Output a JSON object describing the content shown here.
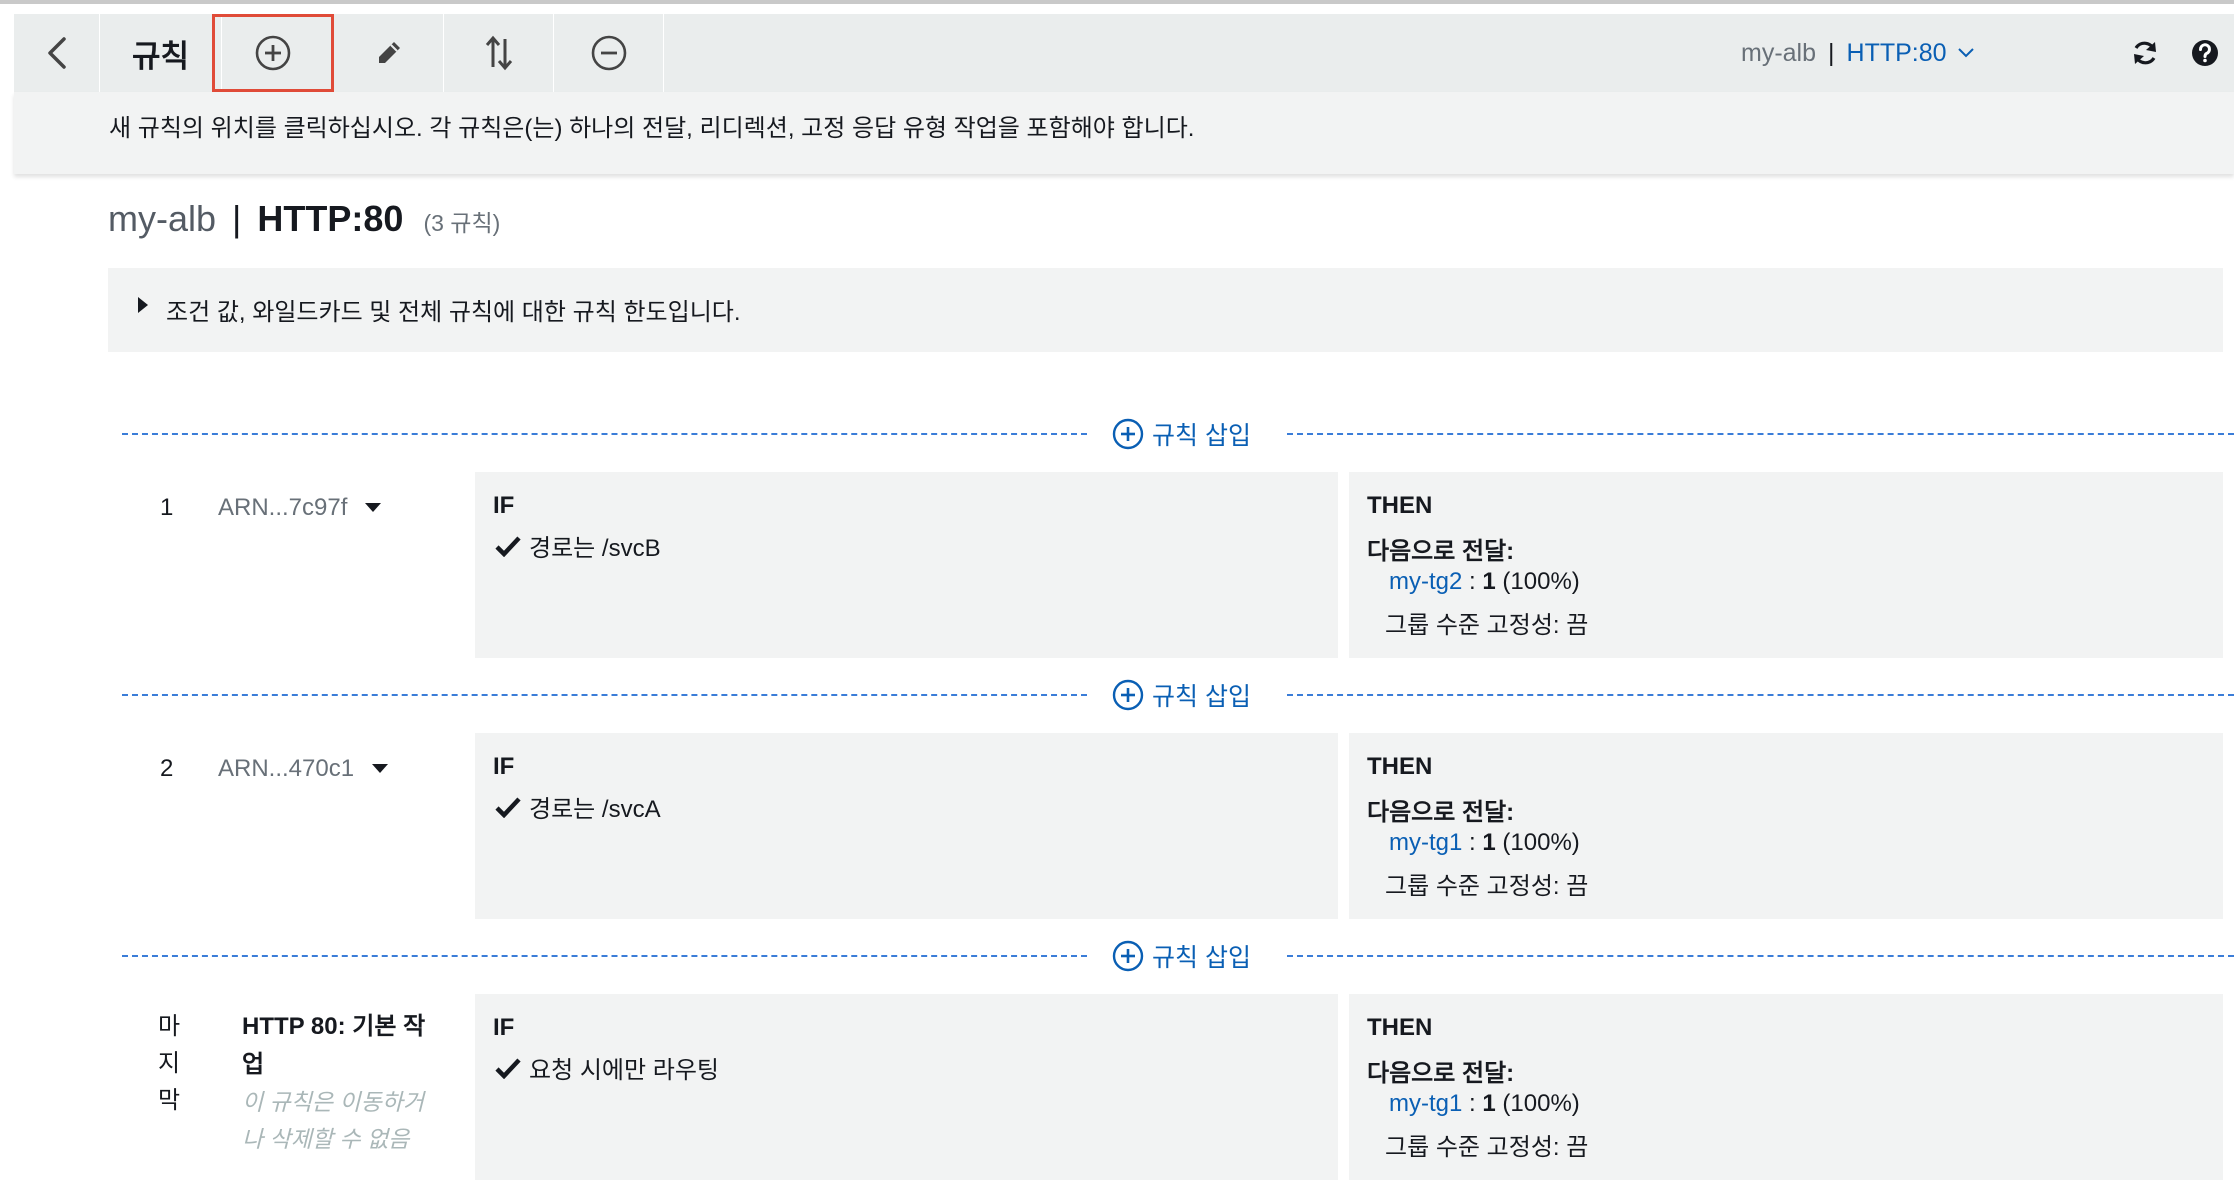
{
  "toolbar": {
    "title": "규칙",
    "buttons": [
      "back",
      "add",
      "edit",
      "reorder",
      "delete"
    ],
    "lb_name": "my-alb",
    "divider": "|",
    "listener": "HTTP:80"
  },
  "info": {
    "message": "새 규칙의 위치를 클릭하십시오. 각 규칙은(는) 하나의 전달, 리디렉션, 고정 응답 유형 작업을 포함해야 합니다."
  },
  "heading": {
    "lb_name": "my-alb",
    "divider": "|",
    "listener": "HTTP:80",
    "count": "(3 규칙)"
  },
  "limits": {
    "text": "조건 값, 와일드카드 및 전체 규칙에 대한 규칙 한도입니다."
  },
  "insert_label": "규칙 삽입",
  "rules": [
    {
      "number": "1",
      "arn": "ARN...7c97f",
      "if_label": "IF",
      "condition": "경로는 /svcB",
      "then_label": "THEN",
      "action": "다음으로 전달:",
      "target_group": "my-tg2",
      "weight_sep": " : ",
      "weight": "1",
      "percent": "(100%)",
      "stickiness": "그룹 수준 고정성: 끔"
    },
    {
      "number": "2",
      "arn": "ARN...470c1",
      "if_label": "IF",
      "condition": "경로는 /svcA",
      "then_label": "THEN",
      "action": "다음으로 전달:",
      "target_group": "my-tg1",
      "weight_sep": " : ",
      "weight": "1",
      "percent": "(100%)",
      "stickiness": "그룹 수준 고정성: 끔"
    }
  ],
  "default_rule": {
    "label_lines": [
      "마",
      "지",
      "막"
    ],
    "title": "HTTP 80: 기본 작업",
    "note": "이 규칙은 이동하거나 삭제할 수 없음",
    "if_label": "IF",
    "condition": "요청 시에만 라우팅",
    "then_label": "THEN",
    "action": "다음으로 전달:",
    "target_group": "my-tg1",
    "weight_sep": " : ",
    "weight": "1",
    "percent": "(100%)",
    "stickiness": "그룹 수준 고정성: 끔"
  },
  "colors": {
    "link": "#0a5fb4",
    "highlight": "#e04b38",
    "dashed": "#3b7dd8"
  }
}
